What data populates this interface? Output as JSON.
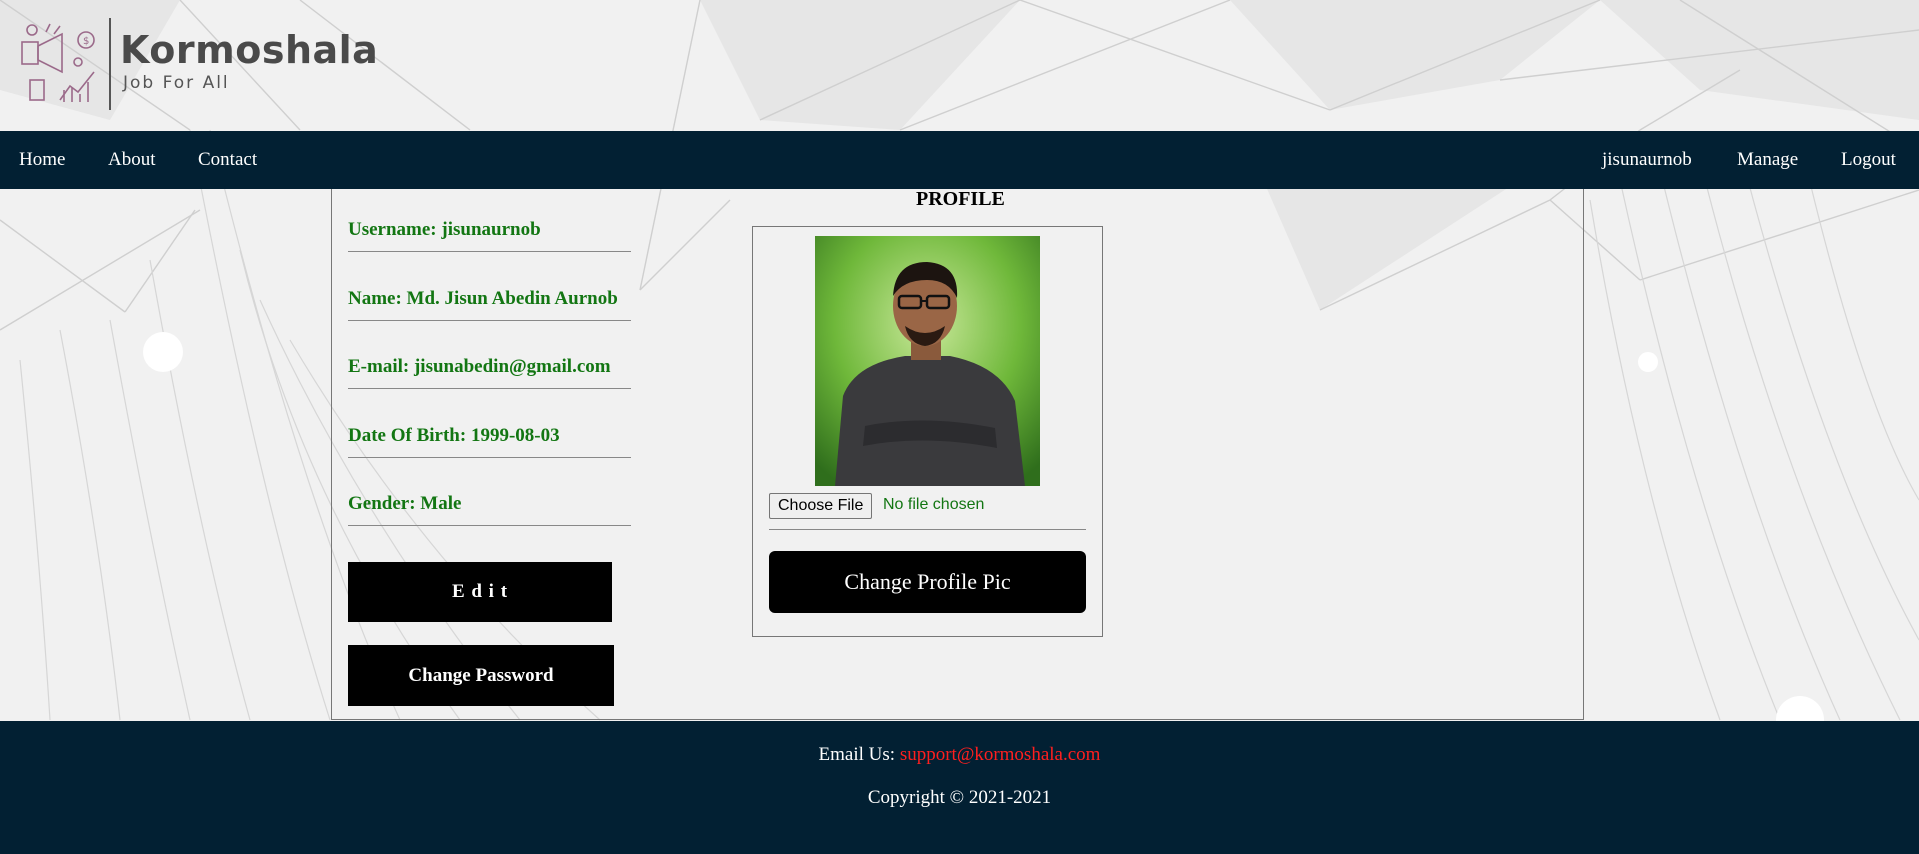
{
  "brand": {
    "name": "Kormoshala",
    "tagline": "Job For All"
  },
  "nav": {
    "left": [
      "Home",
      "About",
      "Contact"
    ],
    "right": [
      "jisunaurnob",
      "Manage",
      "Logout"
    ]
  },
  "profile": {
    "legend": "PROFILE",
    "fields": [
      "Username: jisunaurnob",
      "Name: Md. Jisun Abedin Aurnob",
      "E-mail: jisunabedin@gmail.com",
      "Date Of Birth: 1999-08-03",
      "Gender: Male"
    ],
    "edit_label": "E d i t",
    "change_password_label": "Change Password",
    "choose_file_label": "Choose File",
    "file_status": "No file chosen",
    "change_pic_label": "Change Profile Pic"
  },
  "footer": {
    "email_prefix": "Email Us: ",
    "email": "support@kormoshala.com",
    "copyright": "Copyright © 2021-2021"
  },
  "colors": {
    "nav_bg": "#022033",
    "field_text": "#137613",
    "email_link": "#ff1f1f"
  }
}
